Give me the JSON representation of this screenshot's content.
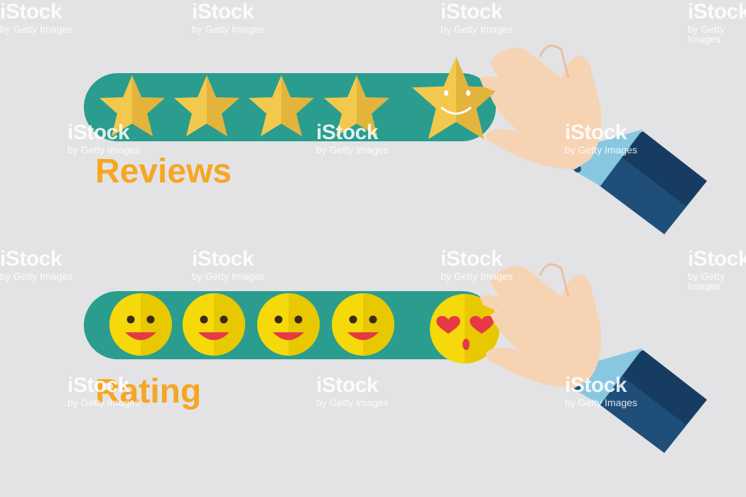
{
  "labels": {
    "reviews": "Reviews",
    "rating": "Rating"
  },
  "watermark": {
    "brand": "iStock",
    "credit": "by Getty Images"
  },
  "reviews": {
    "stars_total": 5,
    "stars_filled": 5,
    "selected_index": 4
  },
  "rating": {
    "faces_total": 5,
    "selected_index": 4
  },
  "colors": {
    "background": "#e3e3e5",
    "track": "#2a9d8f",
    "star": "#f2c94c",
    "face": "#f5d90a",
    "label": "#f5a623",
    "sleeve": "#1f4e79",
    "cuff": "#87c8e0",
    "skin": "#f6d3b3"
  }
}
